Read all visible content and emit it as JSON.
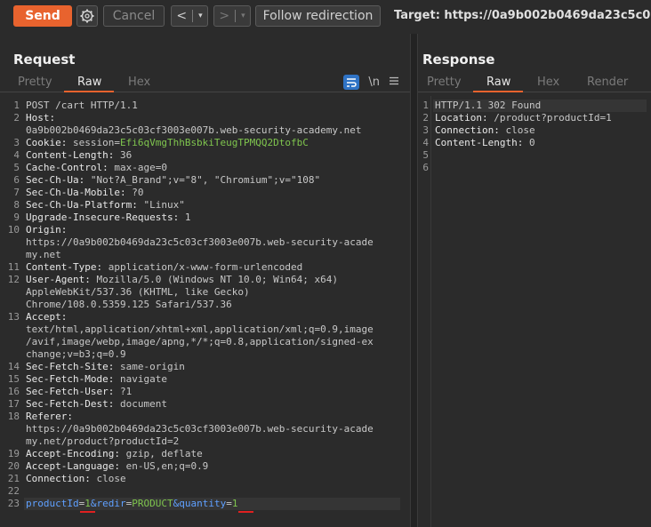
{
  "toolbar": {
    "send": "Send",
    "cancel": "Cancel",
    "back": "<",
    "forward": ">",
    "caret": "▾",
    "follow": "Follow redirection",
    "target": "Target: https://0a9b002b0469da23c5c03cf3"
  },
  "request": {
    "title": "Request",
    "tabs": [
      "Pretty",
      "Raw",
      "Hex"
    ],
    "active_tab": "Raw",
    "icon_wrap_label": "\\n",
    "lines": [
      {
        "n": "1",
        "parts": [
          [
            "POST /cart HTTP/1.1",
            "hval"
          ]
        ]
      },
      {
        "n": "2",
        "parts": [
          [
            "Host:",
            "hname"
          ]
        ]
      },
      {
        "n": "",
        "parts": [
          [
            "0a9b002b0469da23c5c03cf3003e007b.web-security-academy.net",
            "hval"
          ]
        ]
      },
      {
        "n": "3",
        "parts": [
          [
            "Cookie: ",
            "hname"
          ],
          [
            "session=",
            "hval"
          ],
          [
            "Efi6qVmgThhBsbkiTeugTPMQQ2DtofbC",
            "cookie"
          ]
        ]
      },
      {
        "n": "4",
        "parts": [
          [
            "Content-Length: ",
            "hname"
          ],
          [
            "36",
            "hval"
          ]
        ]
      },
      {
        "n": "5",
        "parts": [
          [
            "Cache-Control: ",
            "hname"
          ],
          [
            "max-age=0",
            "hval"
          ]
        ]
      },
      {
        "n": "6",
        "parts": [
          [
            "Sec-Ch-Ua: ",
            "hname"
          ],
          [
            "\"Not?A_Brand\";v=\"8\", \"Chromium\";v=\"108\"",
            "hval"
          ]
        ]
      },
      {
        "n": "7",
        "parts": [
          [
            "Sec-Ch-Ua-Mobile: ",
            "hname"
          ],
          [
            "?0",
            "hval"
          ]
        ]
      },
      {
        "n": "8",
        "parts": [
          [
            "Sec-Ch-Ua-Platform: ",
            "hname"
          ],
          [
            "\"Linux\"",
            "hval"
          ]
        ]
      },
      {
        "n": "9",
        "parts": [
          [
            "Upgrade-Insecure-Requests: ",
            "hname"
          ],
          [
            "1",
            "hval"
          ]
        ]
      },
      {
        "n": "10",
        "parts": [
          [
            "Origin:",
            "hname"
          ]
        ]
      },
      {
        "n": "",
        "parts": [
          [
            "https://0a9b002b0469da23c5c03cf3003e007b.web-security-acade",
            "hval"
          ]
        ]
      },
      {
        "n": "",
        "parts": [
          [
            "my.net",
            "hval"
          ]
        ]
      },
      {
        "n": "11",
        "parts": [
          [
            "Content-Type: ",
            "hname"
          ],
          [
            "application/x-www-form-urlencoded",
            "hval"
          ]
        ]
      },
      {
        "n": "12",
        "parts": [
          [
            "User-Agent: ",
            "hname"
          ],
          [
            "Mozilla/5.0 (Windows NT 10.0; Win64; x64)",
            "hval"
          ]
        ]
      },
      {
        "n": "",
        "parts": [
          [
            "AppleWebKit/537.36 (KHTML, like Gecko)",
            "hval"
          ]
        ]
      },
      {
        "n": "",
        "parts": [
          [
            "Chrome/108.0.5359.125 Safari/537.36",
            "hval"
          ]
        ]
      },
      {
        "n": "13",
        "parts": [
          [
            "Accept:",
            "hname"
          ]
        ]
      },
      {
        "n": "",
        "parts": [
          [
            "text/html,application/xhtml+xml,application/xml;q=0.9,image",
            "hval"
          ]
        ]
      },
      {
        "n": "",
        "parts": [
          [
            "/avif,image/webp,image/apng,*/*;q=0.8,application/signed-ex",
            "hval"
          ]
        ]
      },
      {
        "n": "",
        "parts": [
          [
            "change;v=b3;q=0.9",
            "hval"
          ]
        ]
      },
      {
        "n": "14",
        "parts": [
          [
            "Sec-Fetch-Site: ",
            "hname"
          ],
          [
            "same-origin",
            "hval"
          ]
        ]
      },
      {
        "n": "15",
        "parts": [
          [
            "Sec-Fetch-Mode: ",
            "hname"
          ],
          [
            "navigate",
            "hval"
          ]
        ]
      },
      {
        "n": "16",
        "parts": [
          [
            "Sec-Fetch-User: ",
            "hname"
          ],
          [
            "?1",
            "hval"
          ]
        ]
      },
      {
        "n": "17",
        "parts": [
          [
            "Sec-Fetch-Dest: ",
            "hname"
          ],
          [
            "document",
            "hval"
          ]
        ]
      },
      {
        "n": "18",
        "parts": [
          [
            "Referer:",
            "hname"
          ]
        ]
      },
      {
        "n": "",
        "parts": [
          [
            "https://0a9b002b0469da23c5c03cf3003e007b.web-security-acade",
            "hval"
          ]
        ]
      },
      {
        "n": "",
        "parts": [
          [
            "my.net/product?productId=2",
            "hval"
          ]
        ]
      },
      {
        "n": "19",
        "parts": [
          [
            "Accept-Encoding: ",
            "hname"
          ],
          [
            "gzip, deflate",
            "hval"
          ]
        ]
      },
      {
        "n": "20",
        "parts": [
          [
            "Accept-Language: ",
            "hname"
          ],
          [
            "en-US,en;q=0.9",
            "hval"
          ]
        ]
      },
      {
        "n": "21",
        "parts": [
          [
            "Connection: ",
            "hname"
          ],
          [
            "close",
            "hval"
          ]
        ]
      },
      {
        "n": "22",
        "parts": [
          [
            "",
            "hval"
          ]
        ]
      },
      {
        "n": "23",
        "parts": [
          [
            "productId",
            "pname"
          ],
          [
            "=",
            "hval"
          ],
          [
            "1",
            "pval"
          ],
          [
            "&redir",
            "pname"
          ],
          [
            "=",
            "hval"
          ],
          [
            "PRODUCT",
            "pval"
          ],
          [
            "&quantity",
            "pname"
          ],
          [
            "=",
            "hval"
          ],
          [
            "1",
            "pval"
          ]
        ]
      }
    ]
  },
  "response": {
    "title": "Response",
    "tabs": [
      "Pretty",
      "Raw",
      "Hex",
      "Render"
    ],
    "active_tab": "Raw",
    "lines": [
      {
        "n": "1",
        "parts": [
          [
            "HTTP/1.1 302 Found",
            "hval"
          ]
        ]
      },
      {
        "n": "2",
        "parts": [
          [
            "Location: ",
            "hname"
          ],
          [
            "/product?productId=1",
            "hval"
          ]
        ]
      },
      {
        "n": "3",
        "parts": [
          [
            "Connection: ",
            "hname"
          ],
          [
            "close",
            "hval"
          ]
        ]
      },
      {
        "n": "4",
        "parts": [
          [
            "Content-Length: ",
            "hname"
          ],
          [
            "0",
            "hval"
          ]
        ]
      },
      {
        "n": "5",
        "parts": [
          [
            "",
            "hval"
          ]
        ]
      },
      {
        "n": "6",
        "parts": [
          [
            "",
            "hval"
          ]
        ]
      }
    ]
  },
  "colors": {
    "accent": "#e8632e",
    "cookie_value": "#7fc54e",
    "param_name": "#5fa0ff",
    "annotation": "#e02020"
  },
  "icons": [
    "gear-icon",
    "wrap-lines-icon",
    "newline-icon",
    "menu-icon"
  ]
}
